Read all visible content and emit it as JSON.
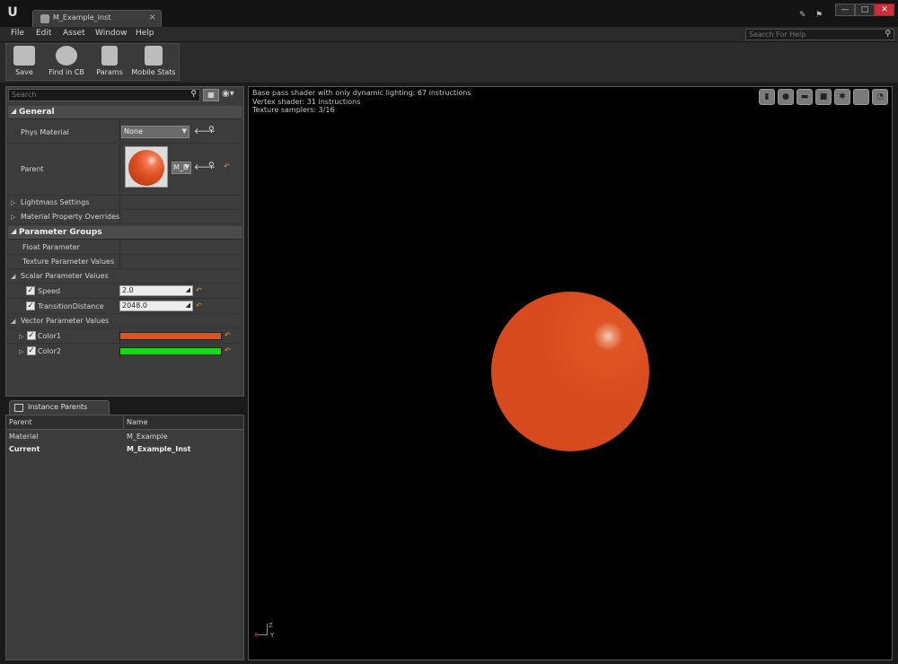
{
  "window": {
    "tab_title": "M_Example_Inst",
    "tab_close": "×",
    "controls": {
      "minimize": "—",
      "maximize": "□",
      "close": "✕"
    }
  },
  "menu": {
    "items": [
      "File",
      "Edit",
      "Asset",
      "Window",
      "Help"
    ],
    "help_search_placeholder": "Search For Help"
  },
  "toolbar": {
    "buttons": [
      "Save",
      "Find in CB",
      "Params",
      "Mobile Stats"
    ]
  },
  "details": {
    "search_placeholder": "Search",
    "general": {
      "header": "General",
      "phys_material_label": "Phys Material",
      "phys_material_value": "None",
      "parent_label": "Parent",
      "parent_value": "M_E",
      "lightmass": "Lightmass Settings",
      "overrides": "Material Property Overrides"
    },
    "param_groups": {
      "header": "Parameter Groups",
      "float_params": "Float Parameter",
      "texture_params": "Texture Parameter Values",
      "scalar_params": "Scalar Parameter Values",
      "speed_label": "Speed",
      "speed_value": "2.0",
      "transition_label": "TransitionDistance",
      "transition_value": "2048.0",
      "vector_params": "Vector Parameter Values",
      "color1_label": "Color1",
      "color1_hex": "#e0531e",
      "color2_label": "Color2",
      "color2_hex": "#19d619"
    }
  },
  "instance_parents": {
    "tab_label": "Instance Parents",
    "columns": [
      "Parent",
      "Name"
    ],
    "rows": [
      {
        "parent": "Material",
        "name": "M_Example",
        "bold": false
      },
      {
        "parent": "Current",
        "name": "M_Example_Inst",
        "bold": true
      }
    ]
  },
  "viewport": {
    "stats": [
      "Base pass shader with only dynamic lighting: 67 instructions",
      "Vertex shader: 31 instructions",
      "Texture samplers: 3/16"
    ],
    "axis": {
      "x": "x",
      "y": "Y",
      "z": "Z"
    },
    "sphere_color": "#d94b1e"
  }
}
